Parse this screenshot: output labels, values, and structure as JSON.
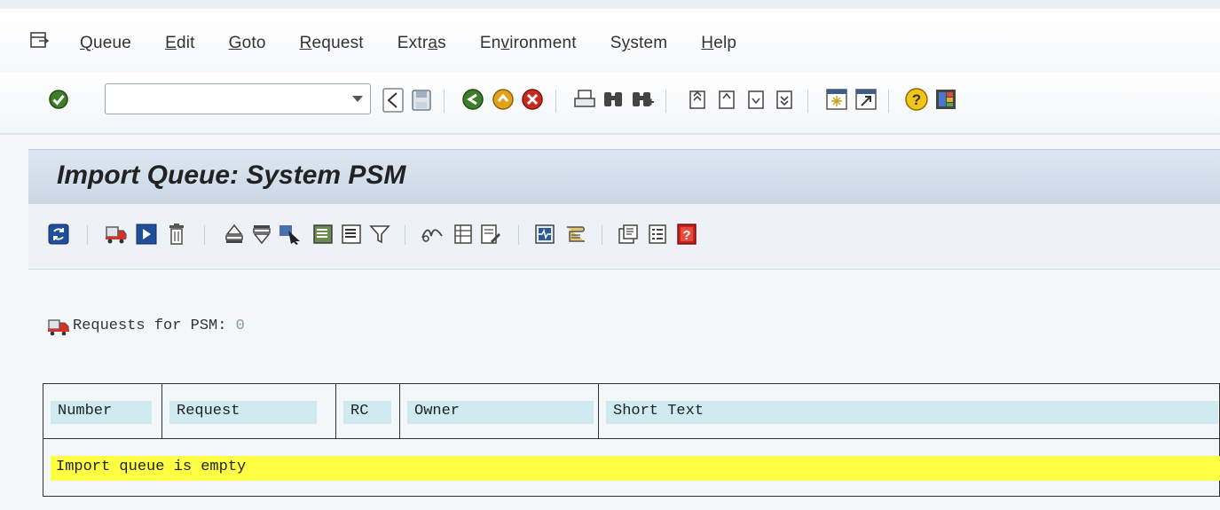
{
  "menubar": {
    "items": [
      {
        "pre": "",
        "u": "Q",
        "post": "ueue"
      },
      {
        "pre": "",
        "u": "E",
        "post": "dit"
      },
      {
        "pre": "",
        "u": "G",
        "post": "oto"
      },
      {
        "pre": "",
        "u": "R",
        "post": "equest"
      },
      {
        "pre": "Extr",
        "u": "a",
        "post": "s"
      },
      {
        "pre": "En",
        "u": "v",
        "post": "ironment"
      },
      {
        "pre": "S",
        "u": "y",
        "post": "stem"
      },
      {
        "pre": "",
        "u": "H",
        "post": "elp"
      }
    ]
  },
  "standard_toolbar": {
    "command_field": {
      "value": "",
      "placeholder": ""
    },
    "icons": [
      "enter-check-icon",
      "back-icon",
      "save-icon",
      "go-back-icon",
      "exit-icon",
      "cancel-icon",
      "print-icon",
      "find-icon",
      "find-next-icon",
      "first-page-icon",
      "previous-page-icon",
      "next-page-icon",
      "last-page-icon",
      "create-session-icon",
      "create-shortcut-icon",
      "help-icon",
      "layout-menu-icon"
    ]
  },
  "screen": {
    "title": "Import Queue: System PSM"
  },
  "content": {
    "requests_label": "Requests for PSM:",
    "requests_count": "0",
    "table": {
      "columns": [
        "Number",
        "Request",
        "RC",
        "Owner",
        "Short Text"
      ],
      "empty_message": "Import queue is empty"
    }
  },
  "colors": {
    "title_band": "#cbd9e8",
    "header_cell": "#cfeaf1",
    "empty_row": "#ffff44"
  }
}
